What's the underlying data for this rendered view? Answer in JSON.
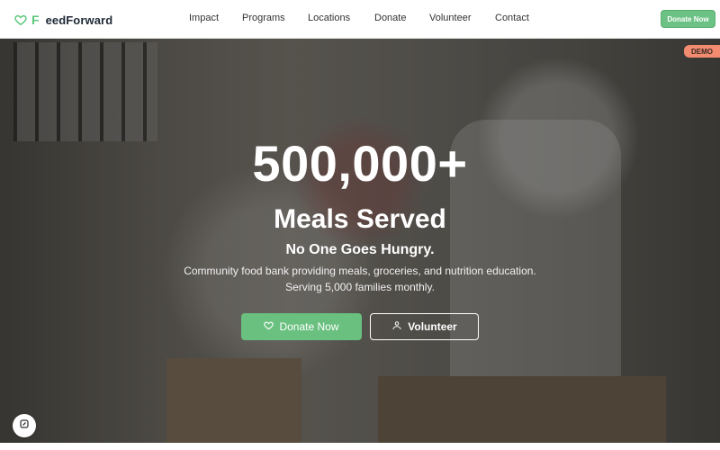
{
  "brand": {
    "f": "F",
    "rest": "eedForward",
    "icon": "heart-outline-icon",
    "accent": "#5ec67a"
  },
  "nav": {
    "items": [
      {
        "label": "Impact"
      },
      {
        "label": "Programs"
      },
      {
        "label": "Locations"
      },
      {
        "label": "Donate"
      },
      {
        "label": "Volunteer"
      },
      {
        "label": "Contact"
      }
    ],
    "cta_label": "Donate Now"
  },
  "badge": {
    "label": "DEMO",
    "color": "#f28b70"
  },
  "hero": {
    "headline": "500,000+",
    "subheadline": "Meals Served",
    "tagline": "No One Goes Hungry.",
    "description": "Community food bank providing meals, groceries, and nutrition education. Serving 5,000 families monthly.",
    "primary_button": {
      "label": "Donate Now",
      "icon": "heart-icon"
    },
    "secondary_button": {
      "label": "Volunteer",
      "icon": "users-icon"
    }
  },
  "floating_button": {
    "icon": "accessibility-icon"
  }
}
